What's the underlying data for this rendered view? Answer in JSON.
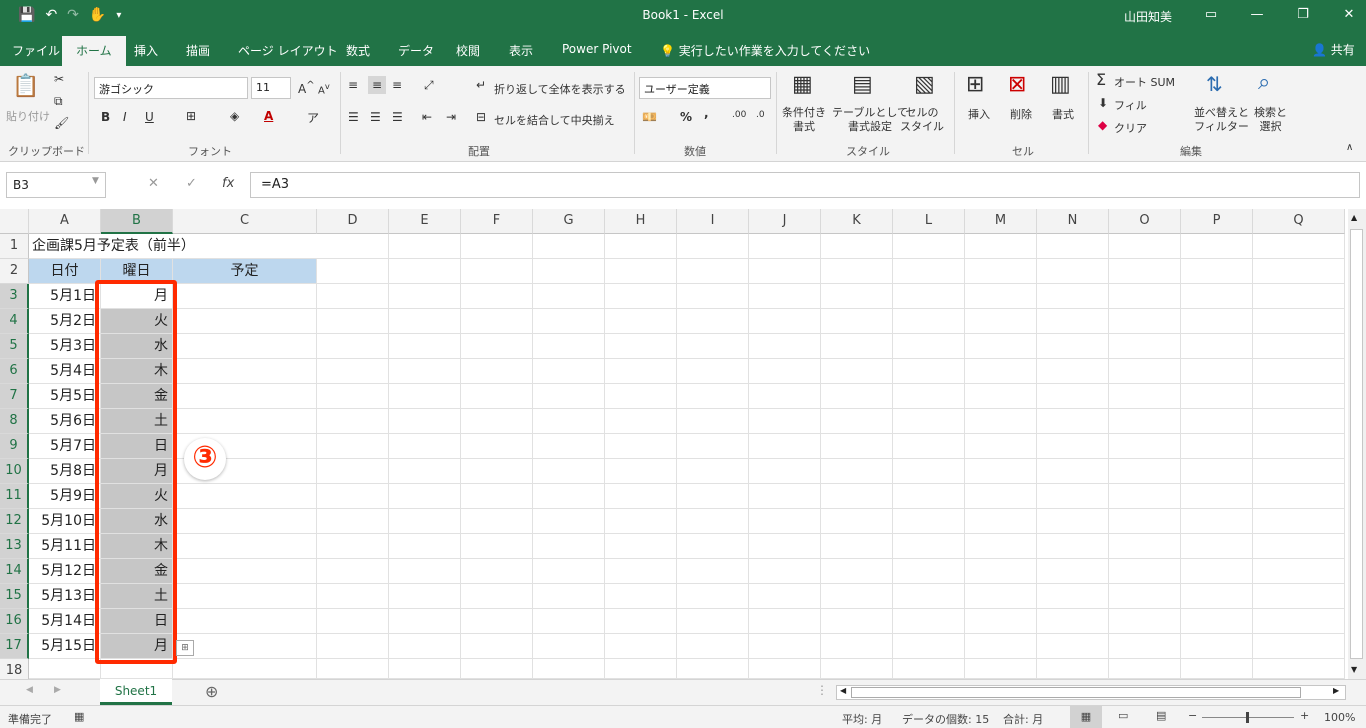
{
  "window": {
    "title": "Book1  -  Excel",
    "user": "山田知美"
  },
  "tabs": [
    "ファイル",
    "ホーム",
    "挿入",
    "描画",
    "ページ レイアウト",
    "数式",
    "データ",
    "校閲",
    "表示",
    "Power Pivot"
  ],
  "tell_me": "実行したい作業を入力してください",
  "share": "共有",
  "ribbon": {
    "clipboard": {
      "paste": "貼り付け",
      "label": "クリップボード"
    },
    "font": {
      "name": "游ゴシック",
      "size": "11",
      "bold": "B",
      "italic": "I",
      "underline": "U",
      "label": "フォント"
    },
    "alignment": {
      "wrap": "折り返して全体を表示する",
      "merge": "セルを結合して中央揃え",
      "label": "配置"
    },
    "number": {
      "format": "ユーザー定義",
      "percent": "%",
      "comma": ",",
      "label": "数値"
    },
    "styles": {
      "conditional": "条件付き\n書式",
      "table": "テーブルとして\n書式設定",
      "cell": "セルの\nスタイル",
      "label": "スタイル"
    },
    "cells": {
      "insert": "挿入",
      "delete": "削除",
      "format": "書式",
      "label": "セル"
    },
    "editing": {
      "autosum": "オート SUM",
      "fill": "フィル",
      "clear": "クリア",
      "sort": "並べ替えと\nフィルター",
      "find": "検索と\n選択",
      "label": "編集"
    }
  },
  "formula_bar": {
    "name_box": "B3",
    "formula": "=A3"
  },
  "columns": [
    "A",
    "B",
    "C",
    "D",
    "E",
    "F",
    "G",
    "H",
    "I",
    "J",
    "K",
    "L",
    "M",
    "N",
    "O",
    "P",
    "Q"
  ],
  "rows": [
    "1",
    "2",
    "3",
    "4",
    "5",
    "6",
    "7",
    "8",
    "9",
    "10",
    "11",
    "12",
    "13",
    "14",
    "15",
    "16",
    "17",
    "18"
  ],
  "sheet": {
    "title": "企画課5月予定表（前半）",
    "headers": [
      "日付",
      "曜日",
      "予定"
    ],
    "dates": [
      "5月1日",
      "5月2日",
      "5月3日",
      "5月4日",
      "5月5日",
      "5月6日",
      "5月7日",
      "5月8日",
      "5月9日",
      "5月10日",
      "5月11日",
      "5月12日",
      "5月13日",
      "5月14日",
      "5月15日"
    ],
    "weekdays": [
      "月",
      "火",
      "水",
      "木",
      "金",
      "土",
      "日",
      "月",
      "火",
      "水",
      "木",
      "金",
      "土",
      "日",
      "月"
    ]
  },
  "annotation": "③",
  "sheet_tab": "Sheet1",
  "status": {
    "ready": "準備完了",
    "average": "平均: 月",
    "count": "データの個数: 15",
    "sum": "合計: 月",
    "zoom": "100%"
  },
  "colors": {
    "accent": "#217346",
    "header_fill": "#bdd7ee",
    "highlight": "#ff2a00"
  }
}
